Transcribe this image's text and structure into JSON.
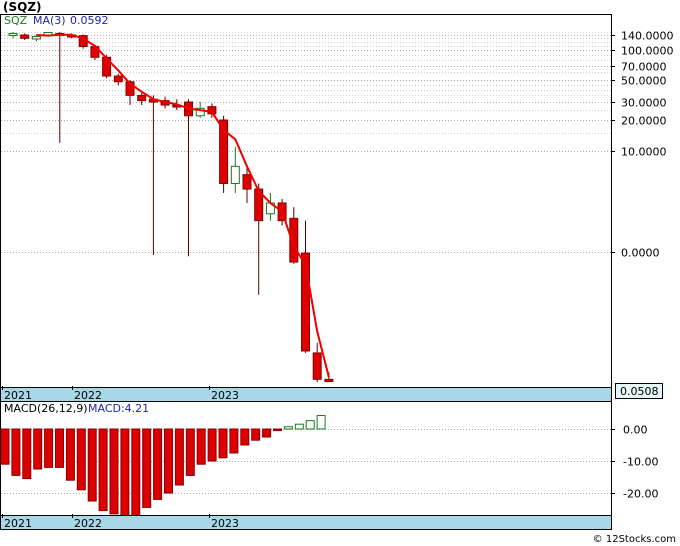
{
  "ticker_title": "(SQZ)",
  "watermark": "© 12Stocks.com",
  "colors": {
    "up_candle": "#1a7a1a",
    "down_candle": "#dd0000",
    "ma_line": "#ee0000",
    "macd_bar": "#dd0000",
    "macd_bar_up": "#1a7a1a",
    "axis_band": "#a8d8e8",
    "grid": "#aaaaaa"
  },
  "chart_data": [
    {
      "type": "candlestick",
      "legend": {
        "symbol": "SQZ",
        "ma_label": "MA(3)",
        "ma_value": "0.0592"
      },
      "price_label": "0.0508",
      "y_scale": "log",
      "y_ticks": [
        "140.0000",
        "100.0000",
        "70.0000",
        "50.0000",
        "30.0000",
        "20.0000",
        "10.0000",
        "0.0000"
      ],
      "x_ticks": [
        "2021",
        "2022",
        "2023"
      ],
      "grid": true,
      "series": [
        {
          "open": 140,
          "close": 145,
          "high": 150,
          "low": 130,
          "dir": "up"
        },
        {
          "open": 140,
          "close": 130,
          "high": 145,
          "low": 125,
          "dir": "down"
        },
        {
          "open": 128,
          "close": 135,
          "high": 140,
          "low": 122,
          "dir": "up"
        },
        {
          "open": 140,
          "close": 148,
          "high": 150,
          "low": 135,
          "dir": "up"
        },
        {
          "open": 145,
          "close": 140,
          "high": 150,
          "low": 12,
          "dir": "down"
        },
        {
          "open": 140,
          "close": 138,
          "high": 145,
          "low": 130,
          "dir": "down"
        },
        {
          "open": 138,
          "close": 108,
          "high": 142,
          "low": 103,
          "dir": "down"
        },
        {
          "open": 108,
          "close": 85,
          "high": 112,
          "low": 80,
          "dir": "down"
        },
        {
          "open": 85,
          "close": 55,
          "high": 90,
          "low": 52,
          "dir": "down"
        },
        {
          "open": 55,
          "close": 48,
          "high": 58,
          "low": 44,
          "dir": "down"
        },
        {
          "open": 48,
          "close": 35,
          "high": 50,
          "low": 28,
          "dir": "down"
        },
        {
          "open": 35,
          "close": 31,
          "high": 37,
          "low": 28,
          "dir": "down"
        },
        {
          "open": 32,
          "close": 30,
          "high": 35,
          "low": 4.5,
          "dir": "down"
        },
        {
          "open": 31,
          "close": 28,
          "high": 34,
          "low": 26,
          "dir": "down"
        },
        {
          "open": 28,
          "close": 27,
          "high": 32,
          "low": 25,
          "dir": "down"
        },
        {
          "open": 30,
          "close": 22,
          "high": 32,
          "low": 4.3,
          "dir": "down"
        },
        {
          "open": 22,
          "close": 26,
          "high": 30,
          "low": 21,
          "dir": "up"
        },
        {
          "open": 27,
          "close": 23,
          "high": 29,
          "low": 21,
          "dir": "down"
        },
        {
          "open": 20,
          "close": 8,
          "high": 22,
          "low": 7.5,
          "dir": "down"
        },
        {
          "open": 8,
          "close": 9,
          "high": 11,
          "low": 7.5,
          "dir": "up"
        },
        {
          "open": 8.5,
          "close": 7.7,
          "high": 9,
          "low": 7,
          "dir": "down"
        },
        {
          "open": 7.7,
          "close": 6.2,
          "high": 8,
          "low": 1.1,
          "dir": "down"
        },
        {
          "open": 6.5,
          "close": 7,
          "high": 7.5,
          "low": 6.2,
          "dir": "up"
        },
        {
          "open": 7,
          "close": 6.2,
          "high": 7.2,
          "low": 6,
          "dir": "down"
        },
        {
          "open": 6.3,
          "close": 3.5,
          "high": 6.8,
          "low": 3.3,
          "dir": "down"
        },
        {
          "open": 4.8,
          "close": 0.15,
          "high": 6.2,
          "low": 0.14,
          "dir": "down"
        },
        {
          "open": 0.14,
          "close": 0.055,
          "high": 0.2,
          "low": 0.05,
          "dir": "down"
        },
        {
          "open": 0.055,
          "close": 0.0508,
          "high": 0.07,
          "low": 0.05,
          "dir": "down"
        }
      ],
      "ma_values": [
        null,
        null,
        140,
        138,
        141,
        141,
        129,
        110,
        83,
        63,
        46,
        38,
        32,
        30,
        28.5,
        26,
        25,
        24,
        16,
        13,
        9,
        7.6,
        7,
        6.6,
        5.2,
        3.2,
        0.3,
        0.0592
      ]
    },
    {
      "type": "bar",
      "legend": {
        "label": "MACD(26,12,9)",
        "value_label": "MACD:4.21"
      },
      "y_ticks": [
        "0.00",
        "-10.00",
        "-20.00"
      ],
      "ylim": [
        -27,
        4
      ],
      "x_ticks": [
        "2021",
        "2022",
        "2023"
      ],
      "values": [
        -11,
        -14.5,
        -15.5,
        -12.5,
        -12,
        -12,
        -16,
        -19,
        -22.5,
        -25.5,
        -26.5,
        -27,
        -27,
        -24.5,
        -22,
        -20,
        -17.5,
        -14.5,
        -11,
        -10,
        -9,
        -7.5,
        -5,
        -3.5,
        -2.5,
        -0.5,
        0.7,
        1.5,
        2.6,
        4.21
      ]
    }
  ]
}
